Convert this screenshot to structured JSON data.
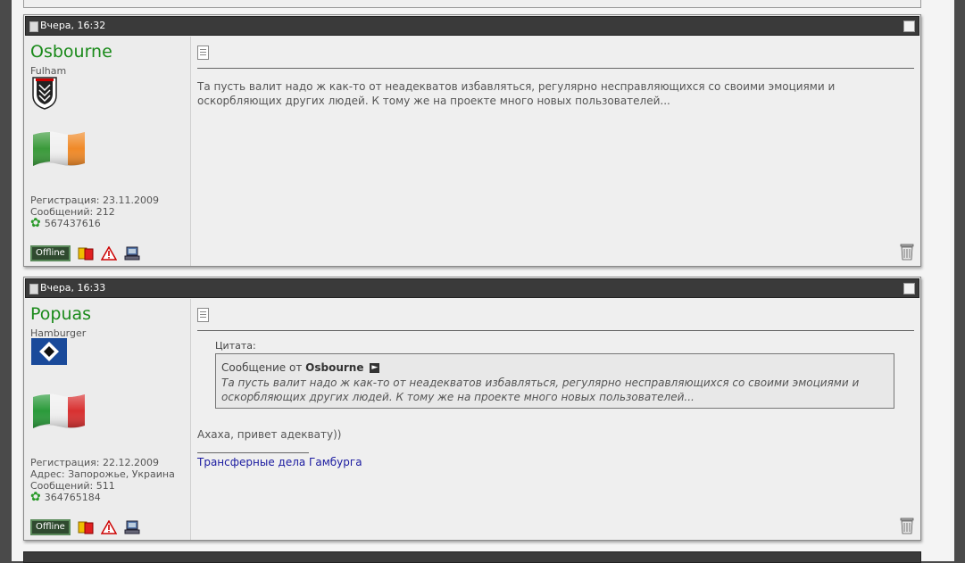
{
  "posts": [
    {
      "date": "Вчера, 16:32",
      "username": "Osbourne",
      "club": "Fulham",
      "registration": "Регистрация: 23.11.2009",
      "posts_count": "Сообщений: 212",
      "icq": "567437616",
      "status": "Offline",
      "message": "Та пусть валит надо ж как-то от неадекватов избавляться, регулярно несправляющихся со своими эмоциями и оскорбляющих других людей. К тому же на проекте много новых пользователей..."
    },
    {
      "date": "Вчера, 16:33",
      "username": "Popuas",
      "club": "Hamburger",
      "registration": "Регистрация: 22.12.2009",
      "address": "Адрес: Запорожье, Украина",
      "posts_count": "Сообщений: 511",
      "icq": "364765184",
      "status": "Offline",
      "quote_label": "Цитата:",
      "quote_prefix": "Сообщение от",
      "quote_author": "Osbourne",
      "quote_text": "Та пусть валит надо ж как-то от неадекватов избавляться, регулярно несправляющихся со своими эмоциями и оскорбляющих других людей. К тому же на проекте много новых пользователей...",
      "message": "Ахаха, привет адеквату))",
      "signature": "Трансферные дела Гамбурга"
    }
  ]
}
